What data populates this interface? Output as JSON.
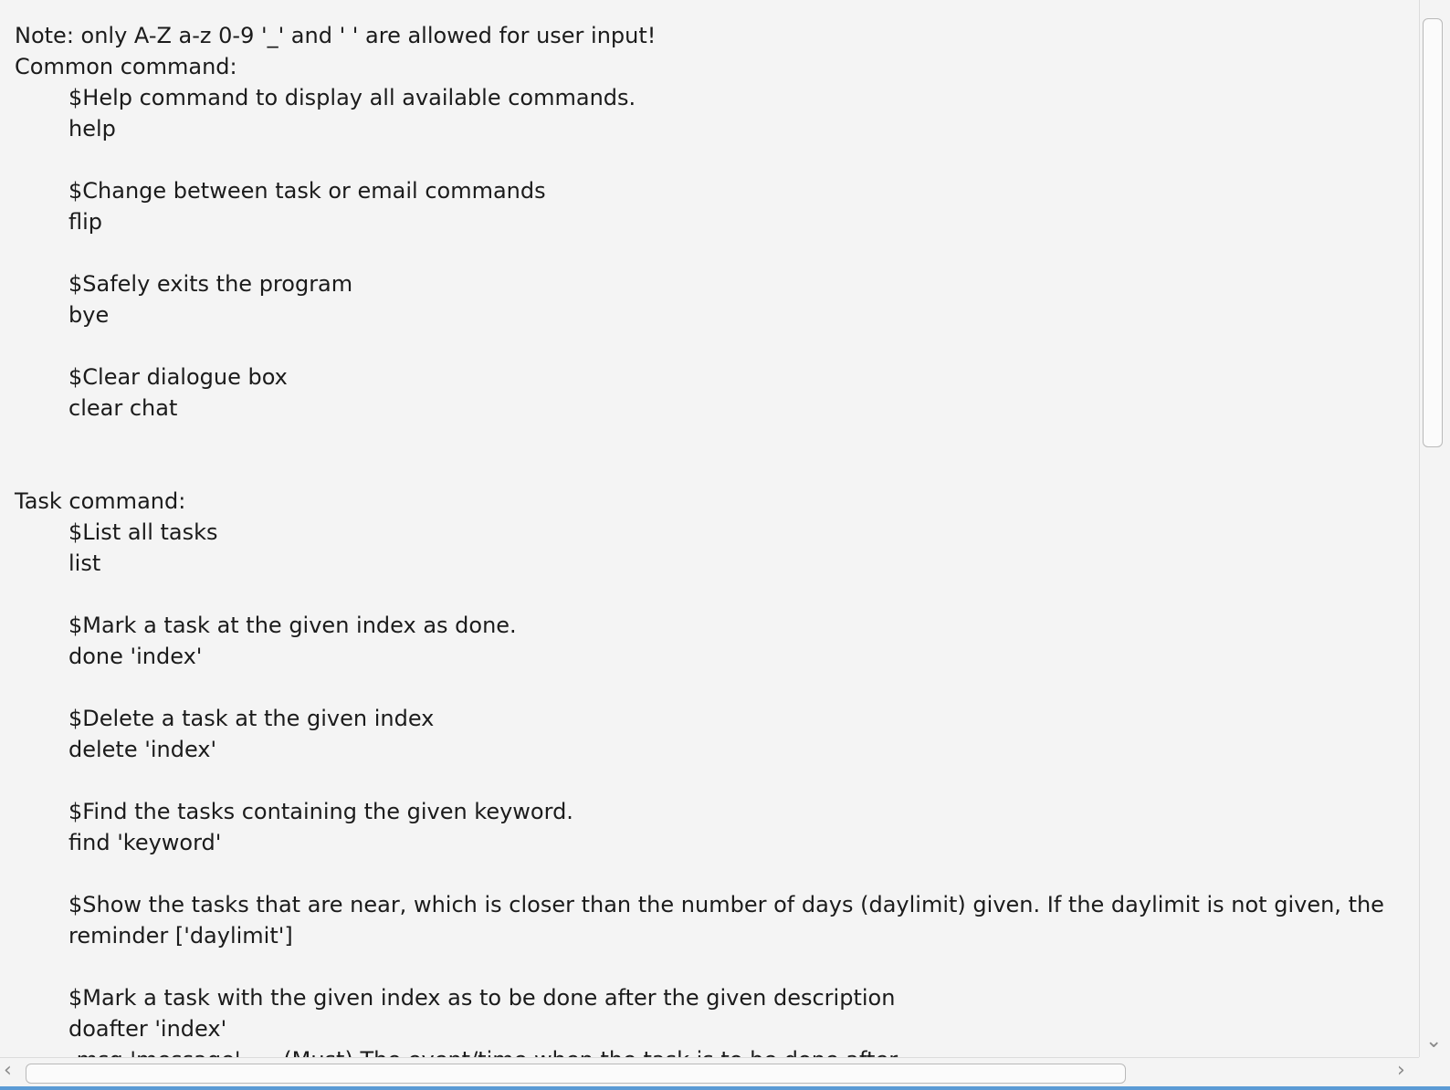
{
  "help_text": {
    "note": "Note: only A-Z a-z 0-9 '_' and ' ' are allowed for user input!",
    "common_heading": "Common command:",
    "common": [
      {
        "desc": "$Help command to display all available commands.",
        "cmd": "help"
      },
      {
        "desc": "$Change between task or email commands",
        "cmd": "flip"
      },
      {
        "desc": "$Safely exits the program",
        "cmd": "bye"
      },
      {
        "desc": "$Clear dialogue box",
        "cmd": "clear chat"
      }
    ],
    "task_heading": "Task command:",
    "task": [
      {
        "desc": "$List all tasks",
        "cmd": "list"
      },
      {
        "desc": "$Mark a task at the given index as done.",
        "cmd": "done 'index'"
      },
      {
        "desc": "$Delete a task at the given index",
        "cmd": "delete 'index'"
      },
      {
        "desc": "$Find the tasks containing the given keyword.",
        "cmd": "find 'keyword'"
      },
      {
        "desc": "$Show the tasks that are near, which is closer than the number of days (daylimit) given. If the daylimit is not given, the",
        "cmd": "reminder ['daylimit']"
      },
      {
        "desc": "$Mark a task with the given index as to be done after the given description",
        "cmd": "doafter 'index'"
      }
    ],
    "cut_line": "-msg 'message' -... (Must) The event/time when the task is to be done after"
  },
  "icons": {
    "scroll_up": "chevron-up-icon",
    "scroll_down": "chevron-down-icon",
    "scroll_left": "chevron-left-icon",
    "scroll_right": "chevron-right-icon"
  },
  "colors": {
    "background": "#f4f4f4",
    "text": "#1b1b1b",
    "accent_border": "#5b9bd5"
  }
}
